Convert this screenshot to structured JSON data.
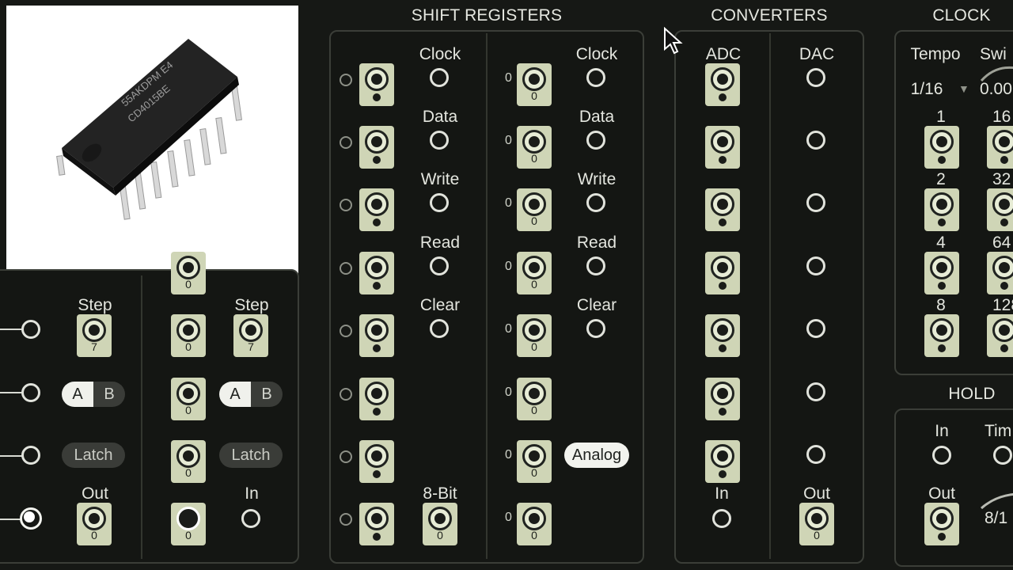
{
  "sections": {
    "shift_registers": "SHIFT REGISTERS",
    "converters": "CONVERTERS",
    "clock": "CLOCK",
    "hold": "HOLD"
  },
  "chip_image": {
    "marking_line1": "55AKDPM E4",
    "marking_line2": "CD4015BE",
    "icon": "ic-chip-image"
  },
  "left_module": {
    "labels": {
      "step_a": "Step",
      "step_b": "Step",
      "out": "Out",
      "in": "In"
    },
    "step_a_value": "7",
    "step_b_value": "7",
    "toggle_a": {
      "a": "A",
      "b": "B"
    },
    "toggle_b": {
      "a": "A",
      "b": "B"
    },
    "latch_a": "Latch",
    "latch_b": "Latch",
    "jack_values": [
      "0",
      "0",
      "0",
      "0",
      "0",
      "0"
    ]
  },
  "shift_registers": {
    "col_a": {
      "labels": [
        "Clock",
        "Data",
        "Write",
        "Read",
        "Clear"
      ],
      "bottom_label": "8-Bit",
      "bottom_value": "0"
    },
    "col_b": {
      "labels": [
        "Clock",
        "Data",
        "Write",
        "Read",
        "Clear"
      ],
      "analog_button": "Analog",
      "indicator_value": "0",
      "jack_value": "0"
    }
  },
  "converters": {
    "adc": "ADC",
    "dac": "DAC",
    "in_label": "In",
    "out_label": "Out",
    "out_value": "0"
  },
  "clock": {
    "tempo_label": "Tempo",
    "swing_label": "Swi",
    "tempo_value": "1/16",
    "swing_value": "0.00",
    "col1_labels": [
      "1",
      "2",
      "4",
      "8"
    ],
    "col2_labels": [
      "16",
      "32",
      "64",
      "128"
    ]
  },
  "hold": {
    "in_label": "In",
    "time_label": "Tim",
    "out_label": "Out",
    "time_value": "8/1"
  }
}
